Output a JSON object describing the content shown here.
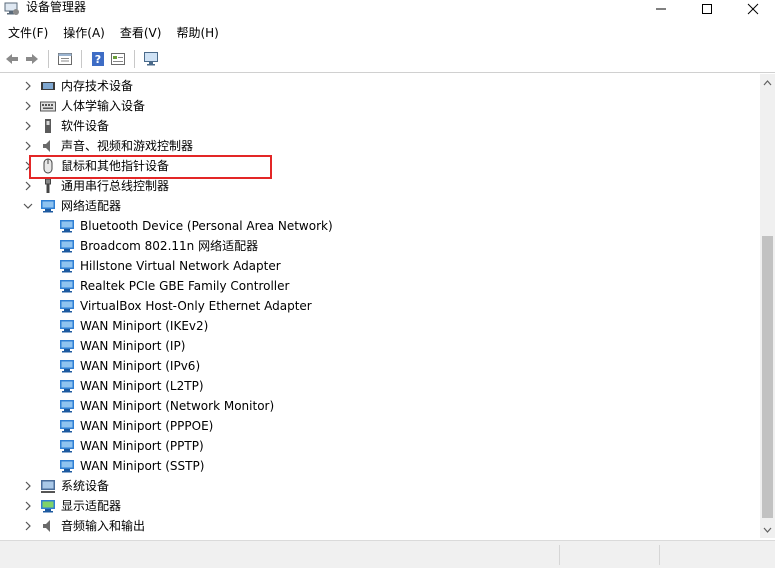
{
  "window": {
    "title": "设备管理器"
  },
  "menu": [
    {
      "label": "文件(F)"
    },
    {
      "label": "操作(A)"
    },
    {
      "label": "查看(V)"
    },
    {
      "label": "帮助(H)"
    }
  ],
  "toolbar": [
    "back-icon",
    "forward-icon",
    "properties-icon",
    "help-icon",
    "view-icon",
    "monitor-icon"
  ],
  "tree": {
    "categories_top": [
      {
        "label": "内存技术设备",
        "icon": "memory-icon"
      },
      {
        "label": "人体学输入设备",
        "icon": "keyboard-icon"
      },
      {
        "label": "软件设备",
        "icon": "software-device-icon"
      },
      {
        "label": "声音、视频和游戏控制器",
        "icon": "speaker-icon"
      },
      {
        "label": "鼠标和其他指针设备",
        "icon": "mouse-icon"
      },
      {
        "label": "通用串行总线控制器",
        "icon": "usb-icon"
      }
    ],
    "network": {
      "label": "网络适配器",
      "children": [
        {
          "label": "Bluetooth Device (Personal Area Network)"
        },
        {
          "label": "Broadcom 802.11n 网络适配器"
        },
        {
          "label": "Hillstone Virtual Network Adapter"
        },
        {
          "label": "Realtek PCIe GBE Family Controller"
        },
        {
          "label": "VirtualBox Host-Only Ethernet Adapter"
        },
        {
          "label": "WAN Miniport (IKEv2)"
        },
        {
          "label": "WAN Miniport (IP)"
        },
        {
          "label": "WAN Miniport (IPv6)"
        },
        {
          "label": "WAN Miniport (L2TP)"
        },
        {
          "label": "WAN Miniport (Network Monitor)"
        },
        {
          "label": "WAN Miniport (PPPOE)"
        },
        {
          "label": "WAN Miniport (PPTP)"
        },
        {
          "label": "WAN Miniport (SSTP)"
        }
      ]
    },
    "categories_bottom": [
      {
        "label": "系统设备",
        "icon": "system-device-icon"
      },
      {
        "label": "显示适配器",
        "icon": "display-adapter-icon"
      },
      {
        "label": "音频输入和输出",
        "icon": "audio-io-icon"
      }
    ]
  },
  "colors": {
    "highlight": "#e32626",
    "adapter": "#2f7fd3"
  }
}
